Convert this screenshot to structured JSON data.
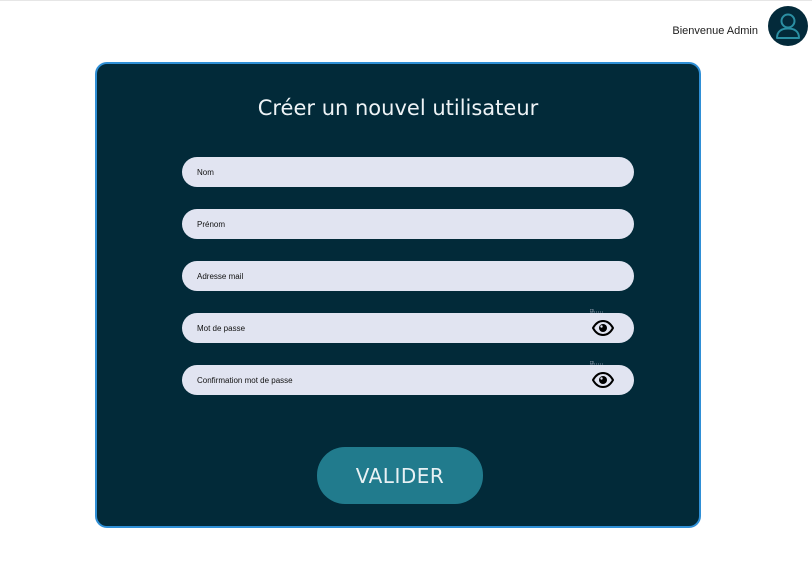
{
  "header": {
    "welcome_text": "Bienvenue Admin",
    "avatar_icon": "user-icon"
  },
  "form": {
    "title": "Créer un nouvel utilisateur",
    "fields": [
      {
        "placeholder": "Nom",
        "value": ""
      },
      {
        "placeholder": "Prénom",
        "value": ""
      },
      {
        "placeholder": "Adresse mail",
        "value": ""
      },
      {
        "placeholder": "Mot de passe",
        "value": "",
        "icon": "eye-icon"
      },
      {
        "placeholder": "Confirmation mot de passe",
        "value": "",
        "icon": "eye-icon"
      }
    ],
    "submit_label": "VALIDER"
  },
  "colors": {
    "card_background": "#022a39",
    "card_border": "#2f8fd6",
    "field_background": "#e1e4f1",
    "button_background": "#217b8d"
  }
}
